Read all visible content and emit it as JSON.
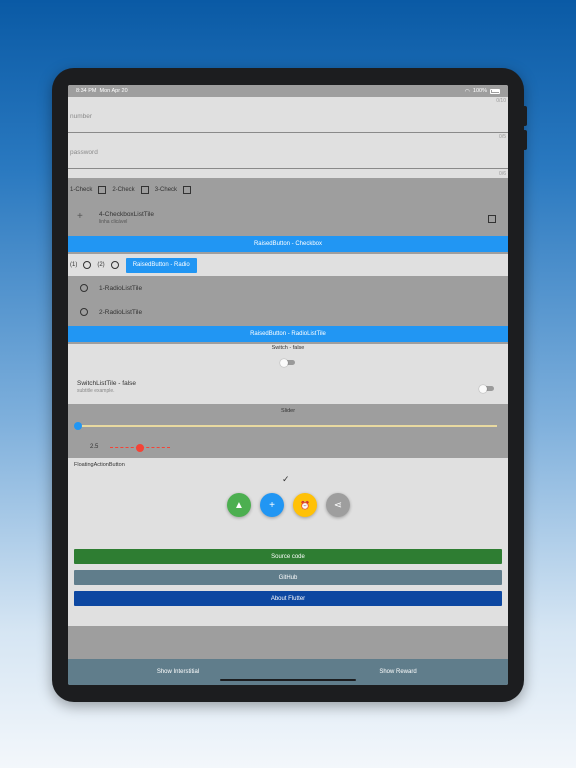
{
  "status": {
    "time": "8:34 PM",
    "date": "Mon Apr 20",
    "battery": "100%"
  },
  "fields": [
    {
      "placeholder": "number",
      "counter": "0/10"
    },
    {
      "placeholder": "password",
      "counter": "0/5"
    }
  ],
  "last_counter": "0/6",
  "checks": {
    "c1": "1-Check",
    "c2": "2-Check",
    "c3": "3-Check"
  },
  "checkbox_tile": {
    "title": "4-CheckboxListTile",
    "subtitle": "linha clicável"
  },
  "raised_checkbox": "RaisedButton - Checkbox",
  "radios": {
    "r1": "(1)",
    "r2": "(2)",
    "button": "RaisedButton - Radio"
  },
  "radio_tiles": [
    "1-RadioListTile",
    "2-RadioListTile"
  ],
  "raised_radio_tile": "RaisedButton - RadioListTile",
  "switch_label": "Switch - false",
  "switch_tile": {
    "title": "SwitchListTile - false",
    "subtitle": "subtitle example."
  },
  "slider": {
    "label": "Slider",
    "value_label": "2.5",
    "value": 0,
    "small_value": 0.5
  },
  "fab_section": {
    "title": "FloatingActionButton",
    "check": "✓"
  },
  "fab_icons": {
    "navigate": "▲",
    "add": "+",
    "alarm": "⏰",
    "share": "⋖"
  },
  "buttons": {
    "source": "Source code",
    "github": "GitHub",
    "about": "About Flutter"
  },
  "bottom": {
    "interstitial": "Show Interstitial",
    "reward": "Show Reward"
  },
  "colors": {
    "accent": "#2196f3",
    "green": "#4caf50",
    "amber": "#ffc107",
    "grey": "#9e9e9e",
    "source": "#2e7d32",
    "github": "#607d8b",
    "about": "#0d47a1",
    "slider_red": "#f44336"
  }
}
